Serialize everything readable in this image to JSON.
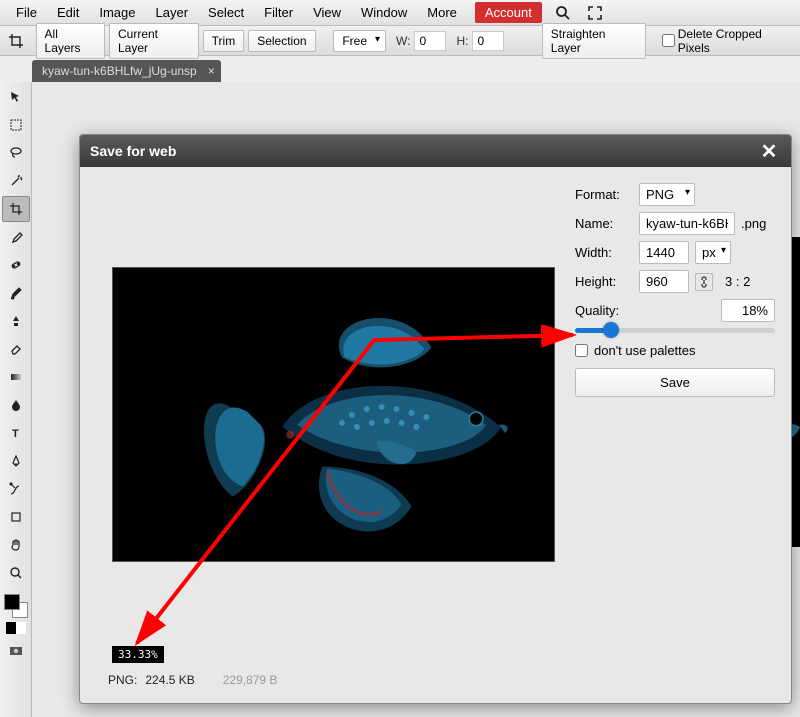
{
  "menu": {
    "items": [
      "File",
      "Edit",
      "Image",
      "Layer",
      "Select",
      "Filter",
      "View",
      "Window",
      "More"
    ],
    "account": "Account"
  },
  "options": {
    "all_layers": "All Layers",
    "current_layer": "Current Layer",
    "trim": "Trim",
    "selection": "Selection",
    "ratio": "Free",
    "w_label": "W:",
    "w_value": "0",
    "h_label": "H:",
    "h_value": "0",
    "straighten": "Straighten Layer",
    "delete_cropped": "Delete Cropped Pixels"
  },
  "tab": {
    "name": "kyaw-tun-k6BHLfw_jUg-unsp"
  },
  "dialog": {
    "title": "Save for web",
    "format_label": "Format:",
    "format_value": "PNG",
    "name_label": "Name:",
    "name_value": "kyaw-tun-k6BHI",
    "name_ext": ".png",
    "width_label": "Width:",
    "width_value": "1440",
    "width_unit": "px",
    "height_label": "Height:",
    "height_value": "960",
    "aspect_ratio": "3 : 2",
    "quality_label": "Quality:",
    "quality_value": "18%",
    "quality_percent": 18,
    "palette_label": "don't use palettes",
    "save": "Save",
    "zoom": "33.33%",
    "file_format": "PNG:",
    "file_size": "224.5 KB",
    "file_bytes": "229,879 B"
  },
  "icons": {
    "search": "search-icon",
    "fullscreen": "fullscreen-icon",
    "link": "link-icon"
  }
}
